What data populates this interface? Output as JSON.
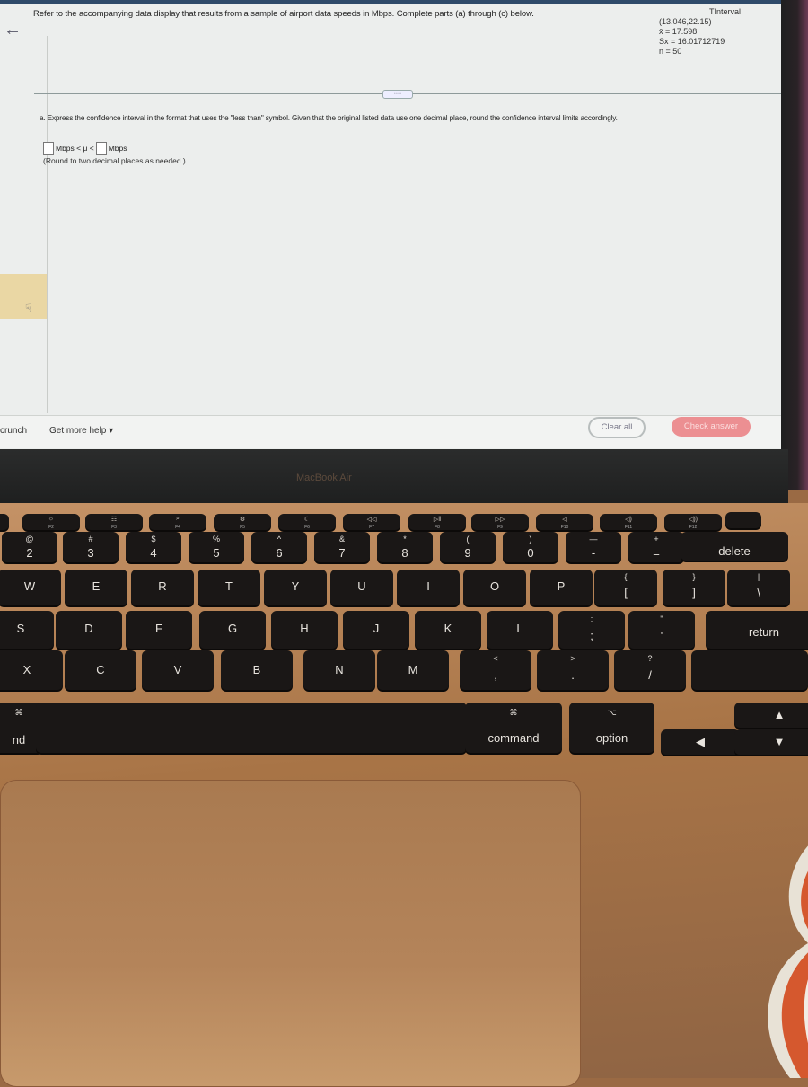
{
  "problem": {
    "intro": "Refer to the accompanying data display that results from a sample of airport data speeds in Mbps. Complete parts (a) through (c) below.",
    "tinterval": {
      "title": "TInterval",
      "interval": "(13.046,22.15)",
      "mean": "x̄ = 17.598",
      "sx": "Sx = 16.01712719",
      "n": "n = 50"
    },
    "divider_handle": "••••",
    "part_a": {
      "question": "a. Express the confidence interval in the format that uses the \"less than\" symbol. Given that the original listed data use one decimal place, round the confidence interval limits accordingly.",
      "lower_value": "",
      "unit_left": "Mbps < μ <",
      "upper_value": "",
      "unit_right": "Mbps",
      "note": "(Round to two decimal places as needed.)"
    }
  },
  "footer": {
    "crunch_label": "crunch",
    "more_help_label": "Get more help ▾",
    "clear_all_label": "Clear all",
    "check_answer_label": "Check answer",
    "check_answer_color": "#ec8f92"
  },
  "laptop": {
    "model_label": "MacBook Air",
    "fn_row": [
      {
        "icon": "☼",
        "label": "F2"
      },
      {
        "icon": "☷",
        "label": "F3"
      },
      {
        "icon": "⌕",
        "label": "F4"
      },
      {
        "icon": "⚙",
        "label": "F5"
      },
      {
        "icon": "☾",
        "label": "F6"
      },
      {
        "icon": "◁◁",
        "label": "F7"
      },
      {
        "icon": "▷‖",
        "label": "F8"
      },
      {
        "icon": "▷▷",
        "label": "F9"
      },
      {
        "icon": "◁",
        "label": "F10"
      },
      {
        "icon": "◁)",
        "label": "F11"
      },
      {
        "icon": "◁))",
        "label": "F12"
      }
    ],
    "number_row": [
      {
        "top": "@",
        "main": "2"
      },
      {
        "top": "#",
        "main": "3"
      },
      {
        "top": "$",
        "main": "4"
      },
      {
        "top": "%",
        "main": "5"
      },
      {
        "top": "^",
        "main": "6"
      },
      {
        "top": "&",
        "main": "7"
      },
      {
        "top": "*",
        "main": "8"
      },
      {
        "top": "(",
        "main": "9"
      },
      {
        "top": ")",
        "main": "0"
      },
      {
        "top": "—",
        "main": "-"
      },
      {
        "top": "+",
        "main": "="
      },
      {
        "top": "",
        "main": "delete"
      }
    ],
    "qwerty_row": [
      "W",
      "E",
      "R",
      "T",
      "Y",
      "U",
      "I",
      "O",
      "P",
      "{ [",
      "} ]",
      "| \\"
    ],
    "home_row": [
      "S",
      "D",
      "F",
      "G",
      "H",
      "J",
      "K",
      "L",
      ": ;",
      "\" '",
      "return"
    ],
    "bottom_row": [
      "X",
      "C",
      "V",
      "B",
      "N",
      "M",
      "< ,",
      "> .",
      "? /"
    ],
    "modifier_row": {
      "left_cmd_symbol": "⌘",
      "left_cmd_label": "nd",
      "right_cmd_symbol": "⌘",
      "right_cmd_label": "command",
      "option_symbol": "⌥",
      "option_label": "option",
      "arrow_left": "◀",
      "arrow_up": "▲",
      "arrow_down": "▼"
    }
  }
}
